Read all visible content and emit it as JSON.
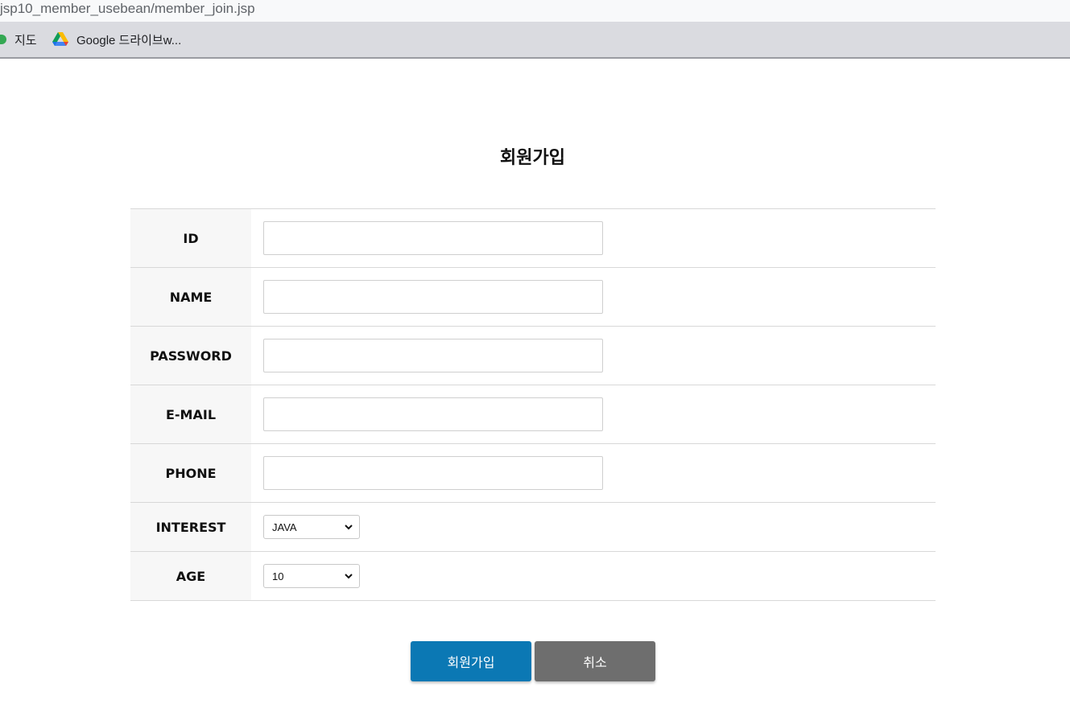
{
  "browser": {
    "url": "jsp10_member_usebean/member_join.jsp",
    "bookmarks": [
      {
        "label": "지도"
      },
      {
        "label": "Google 드라이브w..."
      }
    ]
  },
  "page": {
    "title": "회원가입"
  },
  "form": {
    "fields": [
      {
        "label": "ID",
        "value": ""
      },
      {
        "label": "NAME",
        "value": ""
      },
      {
        "label": "PASSWORD",
        "value": ""
      },
      {
        "label": "E-MAIL",
        "value": ""
      },
      {
        "label": "PHONE",
        "value": ""
      }
    ],
    "interest": {
      "label": "INTEREST",
      "selected": "JAVA"
    },
    "age": {
      "label": "AGE",
      "selected": "10"
    }
  },
  "actions": {
    "submit_label": "회원가입",
    "cancel_label": "취소"
  },
  "colors": {
    "submit": "#0b78b4",
    "cancel": "#6e6e6e",
    "label_bg": "#f7f7f7",
    "border": "#d8d8d8"
  }
}
